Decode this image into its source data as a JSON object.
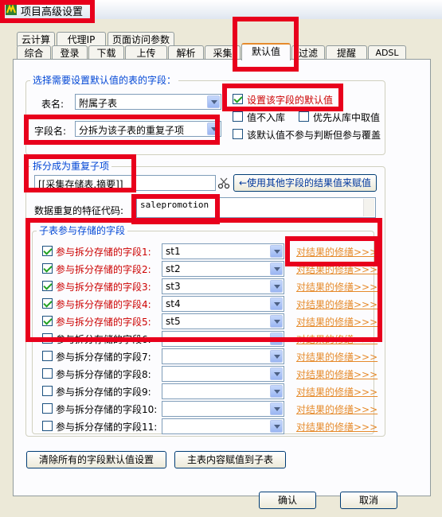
{
  "window": {
    "title": "项目高级设置"
  },
  "tabs_row1": [
    "云计算",
    "代理IP",
    "页面访问参数"
  ],
  "tabs_row2": [
    "综合",
    "登录",
    "下载",
    "上传",
    "解析",
    "采集",
    "默认值",
    "过滤",
    "提醒",
    "ADSL"
  ],
  "select_field": {
    "legend": "选择需要设置默认值的表的字段：",
    "table_label": "表名:",
    "table_value": "附属子表",
    "field_label": "字段名:",
    "field_value": "分拆为该子表的重复子项",
    "set_default_label": "设置该字段的默认值",
    "not_in_db_label": "值不入库",
    "prefer_db_label": "优先从库中取值",
    "no_judge_label": "该默认值不参与判断但参与覆盖"
  },
  "split": {
    "legend": "拆分成为重复子项",
    "source_value": "[[采集存储表.摘要]]",
    "assign_button": "←使用其他字段的结果值来赋值",
    "feature_label": "数据重复的特征代码:",
    "feature_value": "salepromotion"
  },
  "subtable": {
    "legend": "子表参与存储的字段",
    "rows": [
      {
        "label": "参与拆分存储的字段1:",
        "value": "st1",
        "checked": true,
        "link": "对结果的修缮>>>"
      },
      {
        "label": "参与拆分存储的字段2:",
        "value": "st2",
        "checked": true,
        "link": "对结果的修缮>>>"
      },
      {
        "label": "参与拆分存储的字段3:",
        "value": "st3",
        "checked": true,
        "link": "对结果的修缮>>>"
      },
      {
        "label": "参与拆分存储的字段4:",
        "value": "st4",
        "checked": true,
        "link": "对结果的修缮>>>"
      },
      {
        "label": "参与拆分存储的字段5:",
        "value": "st5",
        "checked": true,
        "link": "对结果的修缮>>>"
      },
      {
        "label": "参与拆分存储的字段6:",
        "value": "",
        "checked": false,
        "link": "对结果的修缮>>>"
      },
      {
        "label": "参与拆分存储的字段7:",
        "value": "",
        "checked": false,
        "link": "对结果的修缮>>>"
      },
      {
        "label": "参与拆分存储的字段8:",
        "value": "",
        "checked": false,
        "link": "对结果的修缮>>>"
      },
      {
        "label": "参与拆分存储的字段9:",
        "value": "",
        "checked": false,
        "link": "对结果的修缮>>>"
      },
      {
        "label": "参与拆分存储的字段10:",
        "value": "",
        "checked": false,
        "link": "对结果的修缮>>>"
      },
      {
        "label": "参与拆分存储的字段11:",
        "value": "",
        "checked": false,
        "link": "对结果的修缮>>>"
      }
    ]
  },
  "bottom": {
    "clear_button": "清除所有的字段默认值设置",
    "assign_sub_button": "主表内容赋值到子表"
  },
  "dialog": {
    "ok": "确认",
    "cancel": "取消"
  },
  "colors": {
    "highlight": "#e8001c",
    "link": "#e68b2c",
    "legend": "#0046d5"
  }
}
